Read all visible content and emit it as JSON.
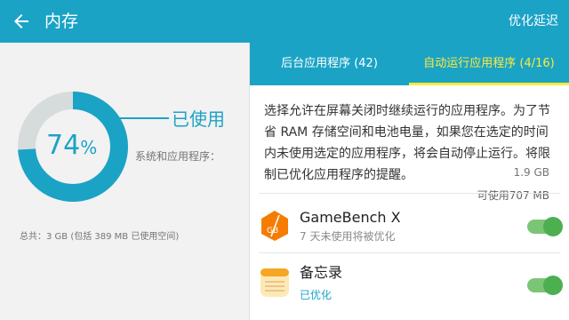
{
  "header": {
    "title": "内存",
    "action": "优化延迟"
  },
  "memory": {
    "used_percent": 74,
    "percent_text": "74",
    "percent_symbol": "%",
    "used_label": "已使用",
    "system_label": "系统和应用程序：",
    "system_value": "1.9 GB",
    "available": "可使用707 MB",
    "total": "总共：3 GB (包括 389 MB 已使用空间)",
    "colors": {
      "used": "#1ba3c6",
      "free": "#d6dcdc"
    }
  },
  "tabs": [
    {
      "label": "后台应用程序 (42)"
    },
    {
      "label": "自动运行应用程序 (4/16)"
    }
  ],
  "description": "选择允许在屏幕关闭时继续运行的应用程序。为了节省 RAM 存储空间和电池电量，如果您在选定的时间内未使用选定的应用程序，将会自动停止运行。将限制已优化应用程序的提醒。",
  "apps": [
    {
      "name": "GameBench X",
      "status": "7 天未使用将被优化",
      "icon": "gamebench-icon",
      "status_color": "#8a8a8a",
      "enabled": true
    },
    {
      "name": "备忘录",
      "status": "已优化",
      "icon": "memo-icon",
      "status_color": "#1ba3c6",
      "enabled": true
    }
  ]
}
